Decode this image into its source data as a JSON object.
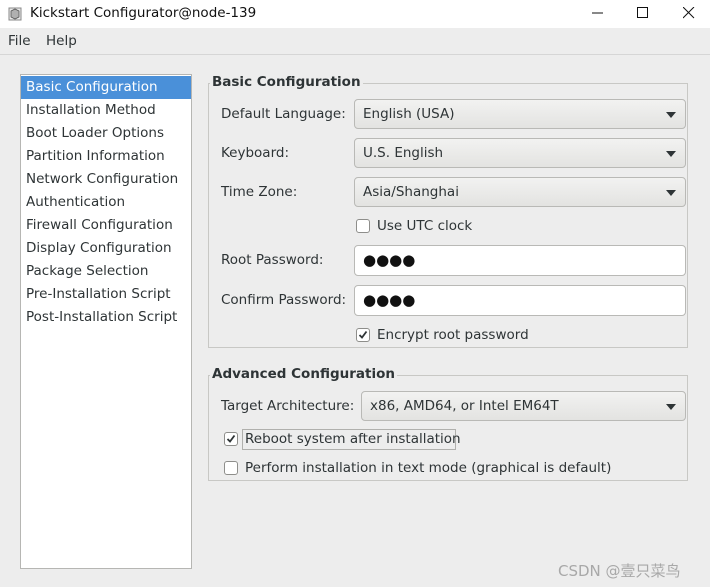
{
  "window": {
    "title": "Kickstart Configurator@node-139"
  },
  "menu": {
    "file": "File",
    "help": "Help"
  },
  "sidebar": {
    "items": [
      {
        "label": "Basic Configuration",
        "selected": true
      },
      {
        "label": "Installation Method",
        "selected": false
      },
      {
        "label": "Boot Loader Options",
        "selected": false
      },
      {
        "label": "Partition Information",
        "selected": false
      },
      {
        "label": "Network Configuration",
        "selected": false
      },
      {
        "label": "Authentication",
        "selected": false
      },
      {
        "label": "Firewall Configuration",
        "selected": false
      },
      {
        "label": "Display Configuration",
        "selected": false
      },
      {
        "label": "Package Selection",
        "selected": false
      },
      {
        "label": "Pre-Installation Script",
        "selected": false
      },
      {
        "label": "Post-Installation Script",
        "selected": false
      }
    ]
  },
  "basic": {
    "title": "Basic Configuration",
    "language_label": "Default Language:",
    "language_value": "English (USA)",
    "keyboard_label": "Keyboard:",
    "keyboard_value": "U.S. English",
    "timezone_label": "Time Zone:",
    "timezone_value": "Asia/Shanghai",
    "utc_label": "Use UTC clock",
    "utc_checked": false,
    "root_pw_label": "Root Password:",
    "root_pw_value": "●●●●",
    "confirm_pw_label": "Confirm Password:",
    "confirm_pw_value": "●●●●",
    "encrypt_label": "Encrypt root password",
    "encrypt_checked": true
  },
  "advanced": {
    "title": "Advanced Configuration",
    "arch_label": "Target Architecture:",
    "arch_value": "x86, AMD64, or Intel EM64T",
    "reboot_label": "Reboot system after installation",
    "reboot_checked": true,
    "textmode_label": "Perform installation in text mode (graphical is default)",
    "textmode_checked": false
  },
  "watermark": "CSDN @壹只菜鸟",
  "colors": {
    "selection": "#4a90d9",
    "background": "#ededed"
  }
}
